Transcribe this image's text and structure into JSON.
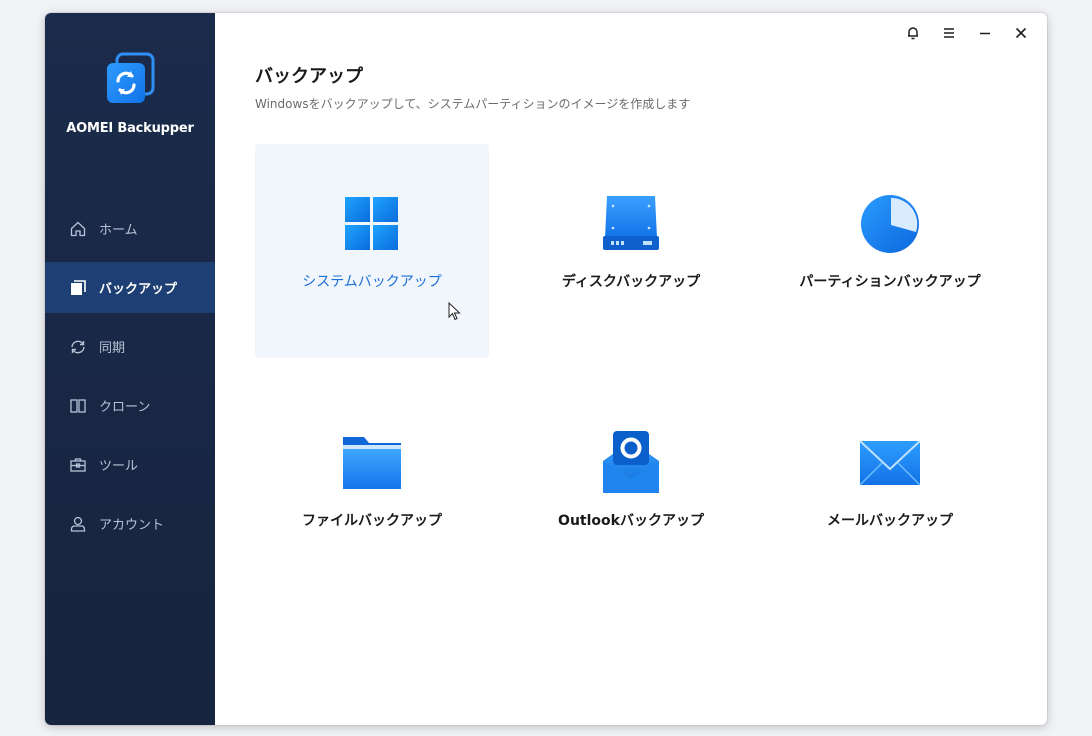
{
  "app": {
    "name": "AOMEI Backupper"
  },
  "nav": {
    "items": [
      {
        "label": "ホーム",
        "icon": "home-icon",
        "active": false
      },
      {
        "label": "バックアップ",
        "icon": "backup-icon",
        "active": true
      },
      {
        "label": "同期",
        "icon": "sync-icon",
        "active": false
      },
      {
        "label": "クローン",
        "icon": "clone-icon",
        "active": false
      },
      {
        "label": "ツール",
        "icon": "tools-icon",
        "active": false
      },
      {
        "label": "アカウント",
        "icon": "account-icon",
        "active": false
      }
    ]
  },
  "window_controls": [
    "bell-icon",
    "menu-icon",
    "minimize-icon",
    "close-icon"
  ],
  "main": {
    "title": "バックアップ",
    "subtitle": "Windowsをバックアップして、システムパーティションのイメージを作成します",
    "tiles": [
      {
        "label": "システムバックアップ",
        "icon": "windows-icon",
        "selected": true
      },
      {
        "label": "ディスクバックアップ",
        "icon": "disk-icon",
        "selected": false
      },
      {
        "label": "パーティションバックアップ",
        "icon": "partition-pie-icon",
        "selected": false
      },
      {
        "label": "ファイルバックアップ",
        "icon": "folder-icon",
        "selected": false
      },
      {
        "label": "Outlookバックアップ",
        "icon": "outlook-icon",
        "selected": false
      },
      {
        "label": "メールバックアップ",
        "icon": "mail-icon",
        "selected": false
      }
    ]
  },
  "colors": {
    "sidebar_bg": "#1b2b4b",
    "sidebar_active": "#1e3f73",
    "accent": "#1c6fd6",
    "tile_selected_bg": "#f1f6fd"
  }
}
